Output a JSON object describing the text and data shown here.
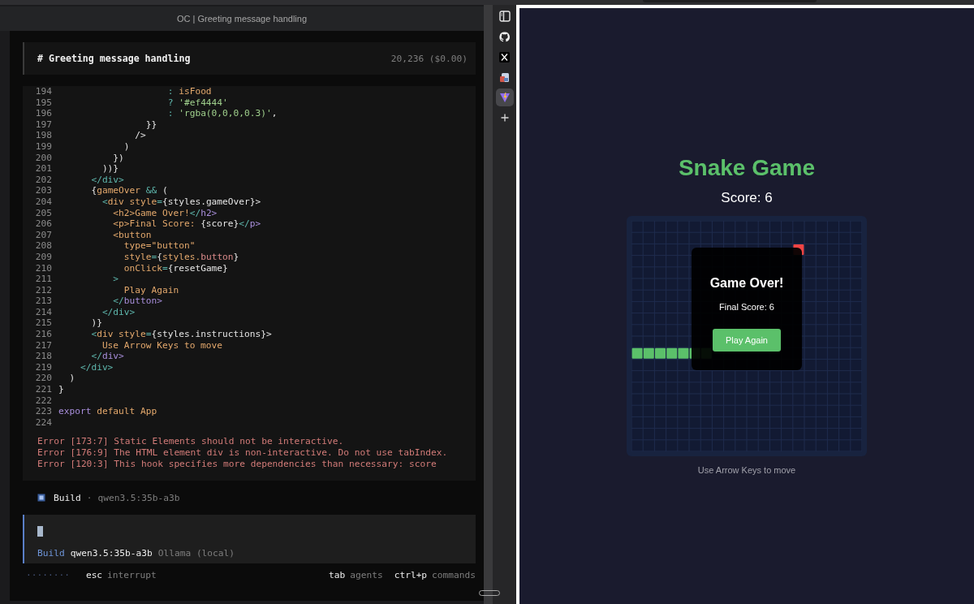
{
  "window": {
    "title": "OC | Greeting message handling"
  },
  "session": {
    "title": "# Greeting message handling",
    "usage": "20,236 ($0.00)"
  },
  "code": {
    "lines": [
      {
        "number": "194",
        "tokens": [
          {
            "text": "                    : ",
            "kind": "op"
          },
          {
            "text": "isFood",
            "kind": "ident"
          }
        ]
      },
      {
        "number": "195",
        "tokens": [
          {
            "text": "                    ? ",
            "kind": "op"
          },
          {
            "text": "'#ef4444'",
            "kind": "string"
          }
        ]
      },
      {
        "number": "196",
        "tokens": [
          {
            "text": "                    : ",
            "kind": "op"
          },
          {
            "text": "'rgba(0,0,0,0.3)'",
            "kind": "string"
          },
          {
            "text": ",",
            "kind": "plain"
          }
        ]
      },
      {
        "number": "197",
        "tokens": [
          {
            "text": "                }}",
            "kind": "plain"
          }
        ]
      },
      {
        "number": "198",
        "tokens": [
          {
            "text": "              />",
            "kind": "plain"
          }
        ]
      },
      {
        "number": "199",
        "tokens": [
          {
            "text": "            )",
            "kind": "plain"
          }
        ]
      },
      {
        "number": "200",
        "tokens": [
          {
            "text": "          })",
            "kind": "plain"
          }
        ]
      },
      {
        "number": "201",
        "tokens": [
          {
            "text": "        ))}",
            "kind": "plain"
          }
        ]
      },
      {
        "number": "202",
        "tokens": [
          {
            "text": "      </div>",
            "kind": "op"
          }
        ]
      },
      {
        "number": "203",
        "tokens": [
          {
            "text": "      {",
            "kind": "plain"
          },
          {
            "text": "gameOver",
            "kind": "ident"
          },
          {
            "text": " && ",
            "kind": "op"
          },
          {
            "text": "(",
            "kind": "plain"
          }
        ]
      },
      {
        "number": "204",
        "tokens": [
          {
            "text": "        <",
            "kind": "op"
          },
          {
            "text": "div style",
            "kind": "ident"
          },
          {
            "text": "=",
            "kind": "op"
          },
          {
            "text": "{styles.gameOver}>",
            "kind": "plain"
          }
        ]
      },
      {
        "number": "205",
        "tokens": [
          {
            "text": "          <h2>Game Over!",
            "kind": "ident"
          },
          {
            "text": "</",
            "kind": "op"
          },
          {
            "text": "h2>",
            "kind": "keyword"
          }
        ]
      },
      {
        "number": "206",
        "tokens": [
          {
            "text": "          <p>Final Score: ",
            "kind": "ident"
          },
          {
            "text": "{score}",
            "kind": "plain"
          },
          {
            "text": "</",
            "kind": "op"
          },
          {
            "text": "p>",
            "kind": "keyword"
          }
        ]
      },
      {
        "number": "207",
        "tokens": [
          {
            "text": "          <button",
            "kind": "ident"
          }
        ]
      },
      {
        "number": "208",
        "tokens": [
          {
            "text": "            type=\"button\"",
            "kind": "ident"
          }
        ]
      },
      {
        "number": "209",
        "tokens": [
          {
            "text": "            style",
            "kind": "ident"
          },
          {
            "text": "=",
            "kind": "op"
          },
          {
            "text": "{",
            "kind": "plain"
          },
          {
            "text": "styles.",
            "kind": "ident"
          },
          {
            "text": "button",
            "kind": "prop"
          },
          {
            "text": "}",
            "kind": "plain"
          }
        ]
      },
      {
        "number": "210",
        "tokens": [
          {
            "text": "            onClick",
            "kind": "ident"
          },
          {
            "text": "=",
            "kind": "op"
          },
          {
            "text": "{resetGame}",
            "kind": "plain"
          }
        ]
      },
      {
        "number": "211",
        "tokens": [
          {
            "text": "          >",
            "kind": "op"
          }
        ]
      },
      {
        "number": "212",
        "tokens": [
          {
            "text": "            Play Again",
            "kind": "ident"
          }
        ]
      },
      {
        "number": "213",
        "tokens": [
          {
            "text": "          </",
            "kind": "op"
          },
          {
            "text": "button>",
            "kind": "keyword"
          }
        ]
      },
      {
        "number": "214",
        "tokens": [
          {
            "text": "        </div>",
            "kind": "op"
          }
        ]
      },
      {
        "number": "215",
        "tokens": [
          {
            "text": "      )}",
            "kind": "plain"
          }
        ]
      },
      {
        "number": "216",
        "tokens": [
          {
            "text": "      <",
            "kind": "op"
          },
          {
            "text": "div style",
            "kind": "ident"
          },
          {
            "text": "=",
            "kind": "op"
          },
          {
            "text": "{styles.instructions}>",
            "kind": "plain"
          }
        ]
      },
      {
        "number": "217",
        "tokens": [
          {
            "text": "        Use Arrow Keys to move",
            "kind": "ident"
          }
        ]
      },
      {
        "number": "218",
        "tokens": [
          {
            "text": "      </",
            "kind": "op"
          },
          {
            "text": "div>",
            "kind": "keyword"
          }
        ]
      },
      {
        "number": "219",
        "tokens": [
          {
            "text": "    </div>",
            "kind": "op"
          }
        ]
      },
      {
        "number": "220",
        "tokens": [
          {
            "text": "  )",
            "kind": "plain"
          }
        ]
      },
      {
        "number": "221",
        "tokens": [
          {
            "text": "}",
            "kind": "plain"
          }
        ]
      },
      {
        "number": "222"
      },
      {
        "number": "223",
        "tokens": [
          {
            "text": "export",
            "kind": "keyword"
          },
          {
            "text": " default App",
            "kind": "ident"
          }
        ]
      },
      {
        "number": "224"
      }
    ]
  },
  "errors": [
    "Error [173:7] Static Elements should not be interactive.",
    "Error [176:9] The HTML element div is non-interactive. Do not use tabIndex.",
    "Error [120:3] This hook specifies more dependencies than necessary: score"
  ],
  "status": {
    "agent": "Build",
    "separator": "·",
    "model": "qwen3.5:35b-a3b"
  },
  "prompt": {
    "agent": "Build",
    "model": "qwen3.5:35b-a3b",
    "provider": "Ollama (local)"
  },
  "footer": {
    "spinner": "········",
    "left_hints": [
      {
        "key": "esc",
        "label": "interrupt"
      }
    ],
    "right_hints": [
      {
        "key": "tab",
        "label": "agents"
      },
      {
        "key": "ctrl+p",
        "label": "commands"
      }
    ]
  },
  "sidebar": {
    "items": [
      {
        "kind": "panel",
        "selected": false
      },
      {
        "kind": "github",
        "selected": false
      },
      {
        "kind": "x",
        "selected": false
      },
      {
        "kind": "app",
        "selected": false
      },
      {
        "kind": "vite",
        "selected": true
      },
      {
        "kind": "add",
        "selected": false
      }
    ]
  },
  "game": {
    "title": "Snake Game",
    "score": "Score: 6",
    "overlay": {
      "title": "Game Over!",
      "final_score": "Final Score: 6",
      "button": "Play Again"
    },
    "instructions": "Use Arrow Keys to move"
  }
}
